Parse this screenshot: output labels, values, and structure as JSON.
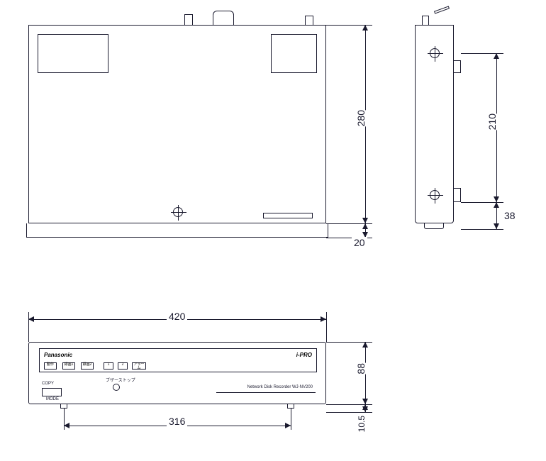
{
  "dimensions": {
    "top_height": "280",
    "base_height": "20",
    "side_height": "210",
    "side_foot": "38",
    "front_width": "420",
    "front_inner_width": "316",
    "front_height": "88",
    "front_foot": "10.5"
  },
  "labels": {
    "brand": "Panasonic",
    "series": "i-PRO",
    "copy": "COPY",
    "mode": "MODE",
    "buzzer": "ブザーストップ",
    "product": "Network Disk Recorder WJ-NV200",
    "led1": "動作",
    "led2": "録画1",
    "led3": "録画2",
    "led4": "1",
    "led5": "2",
    "led6": "アラーム"
  }
}
